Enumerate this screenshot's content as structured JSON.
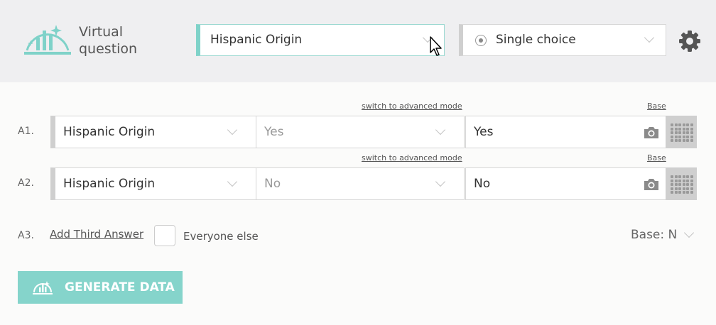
{
  "app": {
    "title": "Virtual\nquestion"
  },
  "header": {
    "question_select": {
      "value": "Hispanic Origin"
    },
    "type_select": {
      "value": "Single choice",
      "icon": "radio-icon"
    }
  },
  "answers": [
    {
      "label": "A1.",
      "advanced_link": "switch to advanced mode",
      "base_link": "Base",
      "variable": "Hispanic Origin",
      "value": "Yes",
      "answer_label": "Yes"
    },
    {
      "label": "A2.",
      "advanced_link": "switch to advanced mode",
      "base_link": "Base",
      "variable": "Hispanic Origin",
      "value": "No",
      "answer_label": "No"
    }
  ],
  "third": {
    "label": "A3.",
    "add_link": "Add Third Answer",
    "checkbox_label": "Everyone else",
    "base": "Base: N"
  },
  "generate": {
    "label": "GENERATE DATA"
  },
  "colors": {
    "accent": "#85d4cb",
    "header_bg": "#efeff1",
    "side_bar": "#cfcfcf"
  }
}
